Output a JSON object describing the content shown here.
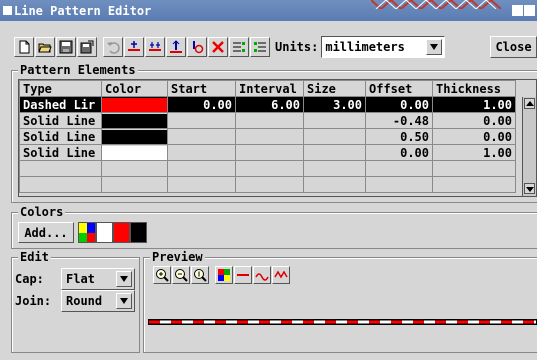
{
  "window": {
    "title": "Line Pattern Editor",
    "accent": "#5b7cb2"
  },
  "toolbar": {
    "icons": [
      "new-pattern-icon",
      "open-pattern-icon",
      "save-pattern-icon",
      "save-as-icon",
      "undo-icon",
      "add-element-icon",
      "insert-element-icon",
      "move-element-icon",
      "rotate-element-icon",
      "delete-element-icon",
      "sort-icon",
      "sort-alt-icon"
    ],
    "units_label": "Units:",
    "units_value": "millimeters",
    "close_label": "Close"
  },
  "pattern_elements": {
    "label": "Pattern Elements",
    "columns": [
      "Type",
      "Color",
      "Start",
      "Interval",
      "Size",
      "Offset",
      "Thickness"
    ],
    "rows": [
      {
        "type": "Dashed Lir",
        "color": "#ff0000",
        "start": "0.00",
        "interval": "6.00",
        "size": "3.00",
        "offset": "0.00",
        "thickness": "1.00",
        "selected": true
      },
      {
        "type": "Solid Line",
        "color": "#000000",
        "start": "",
        "interval": "",
        "size": "",
        "offset": "-0.48",
        "thickness": "0.00",
        "selected": false
      },
      {
        "type": "Solid Line",
        "color": "#000000",
        "start": "",
        "interval": "",
        "size": "",
        "offset": "0.50",
        "thickness": "0.00",
        "selected": false
      },
      {
        "type": "Solid Line",
        "color": "#ffffff",
        "start": "",
        "interval": "",
        "size": "",
        "offset": "0.00",
        "thickness": "1.00",
        "selected": false
      }
    ],
    "empty_rows": 2
  },
  "colors": {
    "label": "Colors",
    "add_label": "Add...",
    "palette": [
      "#ff0000",
      "#ffffff",
      "#ff0000",
      "#000000"
    ]
  },
  "edit": {
    "label": "Edit",
    "cap_label": "Cap:",
    "cap_value": "Flat",
    "join_label": "Join:",
    "join_value": "Round"
  },
  "preview": {
    "label": "Preview",
    "icons": [
      "zoom-in-icon",
      "zoom-out-icon",
      "zoom-full-icon",
      "color-sample-icon",
      "line-straight-icon",
      "line-curve-icon",
      "line-wave-icon"
    ],
    "pattern_colors": [
      "#ff0000",
      "#ffffff",
      "#000000"
    ]
  }
}
